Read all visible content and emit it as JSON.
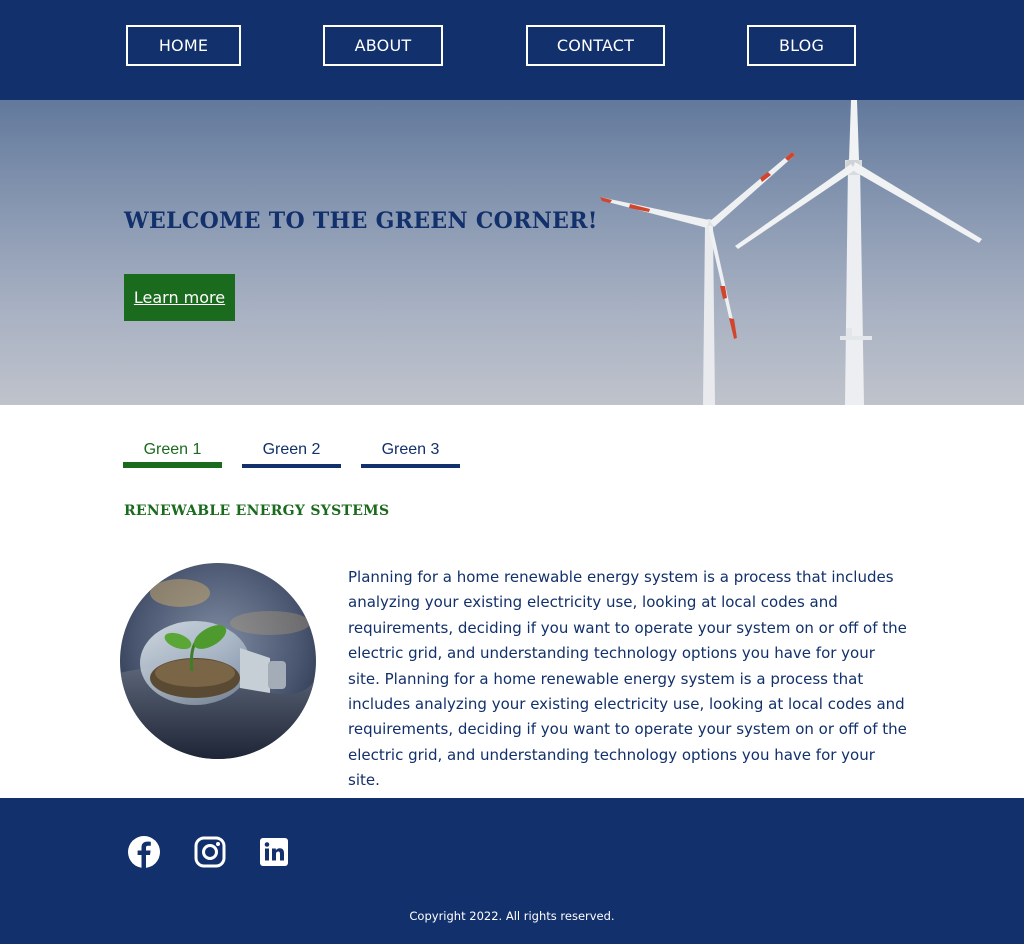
{
  "nav": {
    "items": [
      {
        "label": "HOME"
      },
      {
        "label": "ABOUT"
      },
      {
        "label": "CONTACT"
      },
      {
        "label": "BLOG"
      }
    ]
  },
  "hero": {
    "title": "WELCOME TO THE GREEN CORNER!",
    "button_label": "Learn more",
    "image": "wind-turbines"
  },
  "tabs": [
    {
      "label": "Green 1",
      "active": true
    },
    {
      "label": "Green 2",
      "active": false
    },
    {
      "label": "Green 3",
      "active": false
    }
  ],
  "content": {
    "title": "RENEWABLE ENERGY SYSTEMS",
    "image": "lightbulb-with-plant",
    "paragraph": "Planning for a home renewable energy system is a process that includes analyzing your existing electricity use, looking at local codes and requirements, deciding if you want to operate your system on or off of the electric grid, and understanding technology options you have for your site. Planning for a home renewable energy system is a process that includes analyzing your existing electricity use, looking at local codes and requirements, deciding if you want to operate your system on or off of the electric grid, and understanding technology options you have for your site."
  },
  "footer": {
    "social_icons": [
      "facebook-icon",
      "instagram-icon",
      "linkedin-icon"
    ],
    "copyright": "Copyright 2022. All rights reserved."
  },
  "colors": {
    "navy": "#12306b",
    "green": "#1b6b1e",
    "white": "#ffffff"
  }
}
